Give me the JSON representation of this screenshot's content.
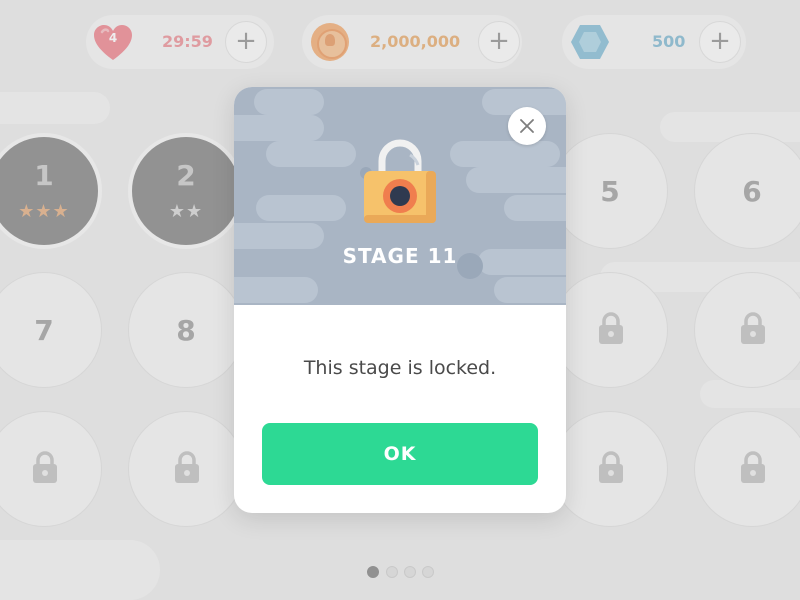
{
  "hud": {
    "lives": {
      "count": "4",
      "timer": "29:59",
      "icon": "heart-icon",
      "color": "#ef8f98"
    },
    "coins": {
      "amount": "2,000,000",
      "icon": "coin-icon",
      "color": "#f1b479"
    },
    "gems": {
      "amount": "500",
      "icon": "gem-icon",
      "color": "#8fc3da"
    },
    "plus_label": "+"
  },
  "levels": [
    {
      "number": "1",
      "stars": "★★★",
      "state": "completed"
    },
    {
      "number": "2",
      "stars": "★★",
      "state": "completed"
    },
    {
      "number": "5",
      "state": "available"
    },
    {
      "number": "6",
      "state": "available"
    },
    {
      "number": "7",
      "state": "available"
    },
    {
      "number": "8",
      "state": "available"
    }
  ],
  "pagination": {
    "pages": 4,
    "current": 1
  },
  "modal": {
    "title": "STAGE 11",
    "message": "This stage is locked.",
    "ok_label": "OK",
    "icon": "lock-icon",
    "accent_color": "#2dd994",
    "header_color": "#a9b5c4"
  }
}
